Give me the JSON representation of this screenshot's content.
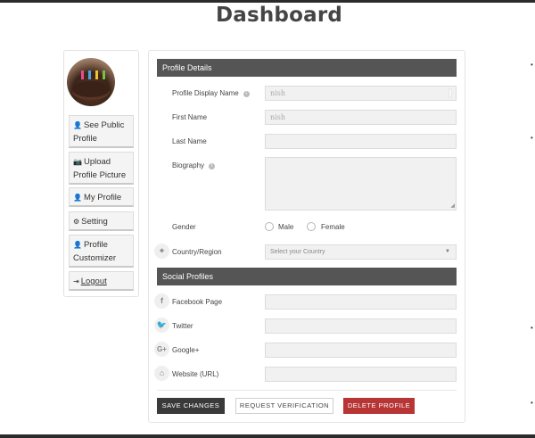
{
  "page": {
    "title": "Dashboard"
  },
  "sidebar": {
    "items": [
      {
        "icon": "user-icon",
        "label": "See Public Profile"
      },
      {
        "icon": "camera-icon",
        "label": "Upload Profile Picture"
      },
      {
        "icon": "user-icon",
        "label": "My Profile"
      },
      {
        "icon": "gear-icon",
        "label": "Setting"
      },
      {
        "icon": "user-icon",
        "label": "Profile Customizer"
      },
      {
        "icon": "logout-icon",
        "label": "Logout"
      }
    ]
  },
  "profile_details": {
    "heading": "Profile Details",
    "display_name": {
      "label": "Profile Display Name",
      "value": "nish"
    },
    "first_name": {
      "label": "First Name",
      "value": "nish"
    },
    "last_name": {
      "label": "Last Name",
      "value": ""
    },
    "biography": {
      "label": "Biography",
      "value": ""
    },
    "gender": {
      "label": "Gender",
      "options": [
        "Male",
        "Female"
      ]
    },
    "country": {
      "label": "Country/Region",
      "placeholder": "Select your Country"
    }
  },
  "social_profiles": {
    "heading": "Social Profiles",
    "facebook": {
      "label": "Facebook Page",
      "value": ""
    },
    "twitter": {
      "label": "Twitter",
      "value": ""
    },
    "google": {
      "label": "Google+",
      "value": ""
    },
    "website": {
      "label": "Website (URL)",
      "value": ""
    }
  },
  "actions": {
    "save": "SAVE CHANGES",
    "verify": "REQUEST VERIFICATION",
    "delete": "DELETE PROFILE"
  },
  "colors": {
    "section_bar": "#555555",
    "save_button": "#3a3a3a",
    "delete_button": "#b73535"
  }
}
